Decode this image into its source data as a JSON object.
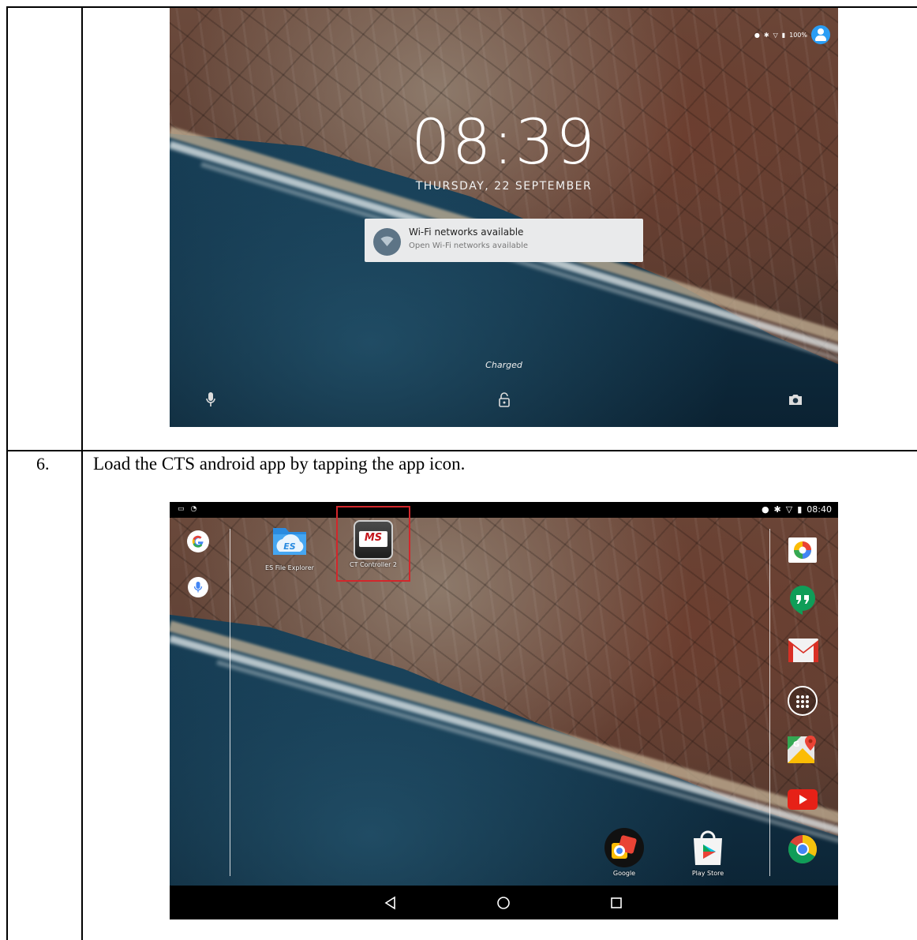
{
  "step": {
    "number": "6.",
    "instruction": "Load the CTS android app by tapping the app icon."
  },
  "lock_screen": {
    "status_battery": "100%",
    "time": "08:39",
    "date": "THURSDAY, 22 SEPTEMBER",
    "notification": {
      "title": "Wi-Fi networks available",
      "subtitle": "Open Wi-Fi networks available"
    },
    "charging_status": "Charged"
  },
  "home_screen": {
    "status_time": "08:40",
    "apps": [
      {
        "label": "ES File Explorer",
        "icon": "es-file-explorer-icon"
      },
      {
        "label": "CT Controller 2",
        "icon": "ct-controller-icon",
        "badge": "MS"
      }
    ],
    "dock_apps": [
      {
        "label": "Google",
        "icon": "google-photos-folder-icon"
      },
      {
        "label": "Play Store",
        "icon": "play-store-icon"
      }
    ],
    "highlight_color": "#d3262b"
  }
}
